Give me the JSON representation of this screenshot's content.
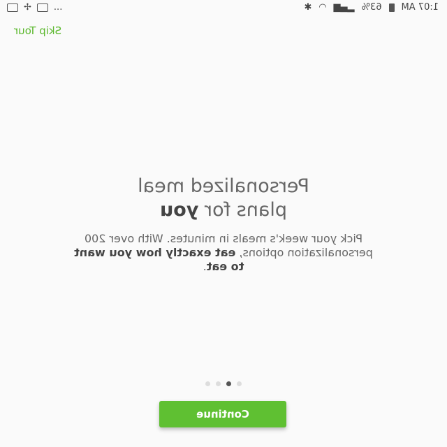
{
  "status_bar": {
    "time": "1:07 AM",
    "battery": "63%",
    "more": "..."
  },
  "skip_label": "Skip Tour",
  "title": {
    "line1": "Personalized meal",
    "line2_prefix": "plans for ",
    "line2_bold": "you"
  },
  "description": {
    "part1": "Pick your week's meals in minutes. With over 200 personalization options, ",
    "bold": "eat exactly how you want to eat",
    "part2": "."
  },
  "pager": {
    "total": 4,
    "active_index": 2
  },
  "continue_label": "Continue",
  "colors": {
    "accent": "#5fc032",
    "skip_text": "#5cb82e"
  }
}
